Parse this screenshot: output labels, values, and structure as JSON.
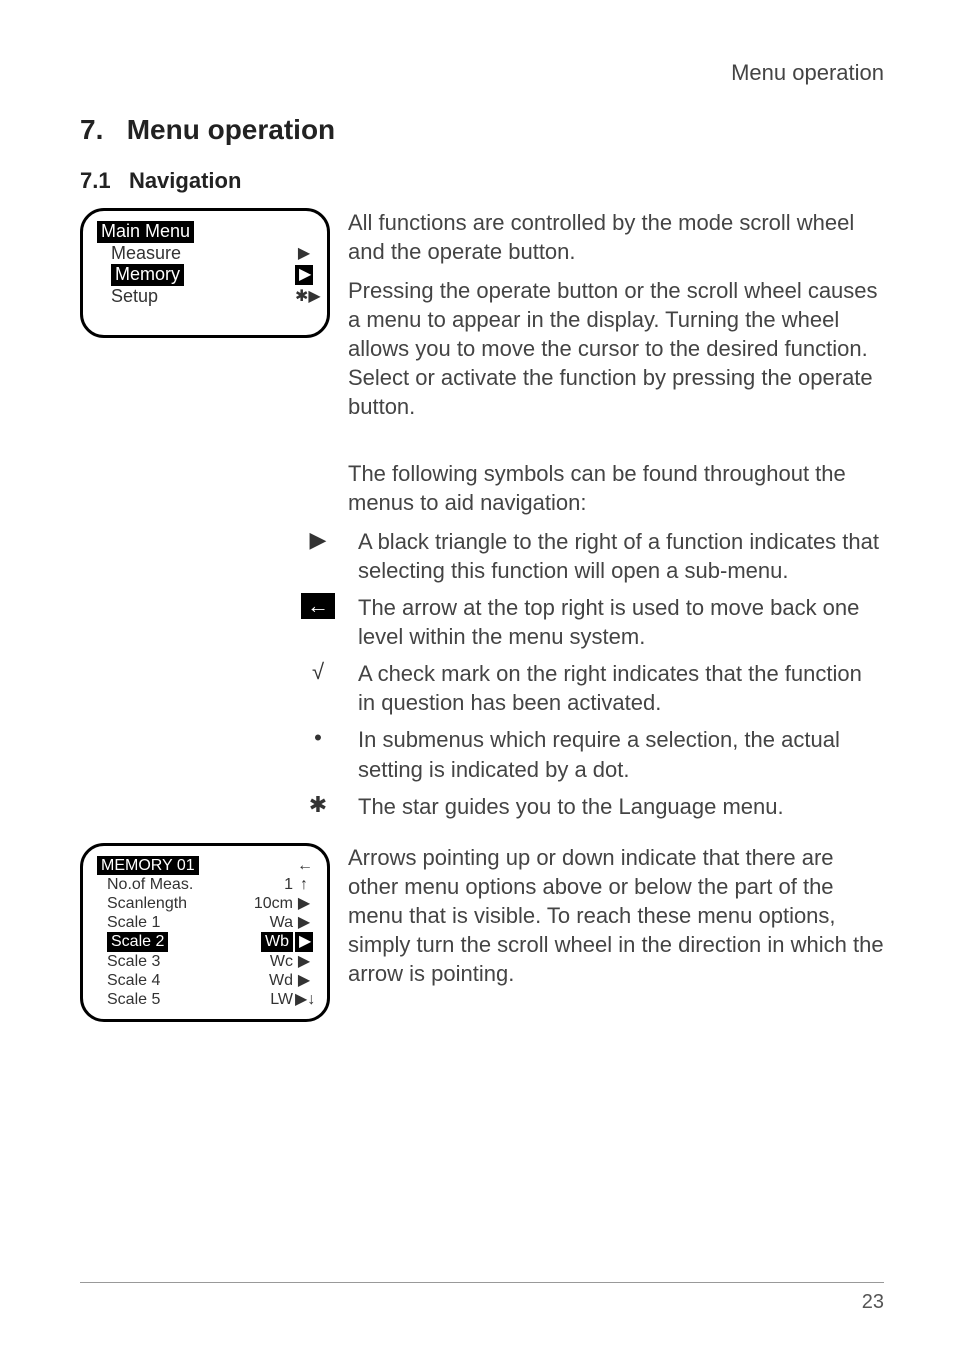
{
  "header": {
    "running": "Menu operation"
  },
  "h1": {
    "num": "7.",
    "title": "Menu operation"
  },
  "h2": {
    "num": "7.1",
    "title": "Navigation"
  },
  "lcd1": {
    "title": "Main Menu",
    "rows": [
      {
        "label": "Measure",
        "arrow": "▶",
        "hl": false
      },
      {
        "label": "Memory",
        "arrow": "▶",
        "hl": true
      },
      {
        "label": "Setup",
        "arrow": "✱▶",
        "hl": false
      }
    ]
  },
  "para1": "All functions are controlled by the mode scroll wheel and the operate button.",
  "para2": "Pressing the operate button or the scroll wheel causes a menu to appear in the display. Turning the wheel allows you to move the cursor to the desired function. Select or activate the function by pressing the operate button.",
  "navIntro": "The following symbols can be found throughout the menus to aid navigation:",
  "symbols": [
    {
      "glyph": "▶",
      "desc": "A black triangle to the right of a function indicates that selecting this function will open a sub-menu."
    },
    {
      "glyph": "←",
      "desc": "The arrow at the top right is used to move back one level within the menu system."
    },
    {
      "glyph": "√",
      "desc": "A check mark on the right indicates that the function in question has been activated."
    },
    {
      "glyph": "•",
      "desc": "In submenus which require a selection, the actual setting is indicated by a dot."
    },
    {
      "glyph": "✱",
      "desc": "The star guides you to the Language menu."
    }
  ],
  "lcd2": {
    "title": "MEMORY 01",
    "back": "←",
    "up": "↑",
    "down": "↓",
    "rows": [
      {
        "label": "No.of Meas.",
        "val": "1",
        "arrow": "",
        "hl": false
      },
      {
        "label": "Scanlength",
        "val": "10cm",
        "arrow": "▶",
        "hl": false
      },
      {
        "label": "Scale  1",
        "val": "Wa",
        "arrow": "▶",
        "hl": false
      },
      {
        "label": "Scale  2",
        "val": "Wb",
        "arrow": "▶",
        "hl": true
      },
      {
        "label": "Scale  3",
        "val": "Wc",
        "arrow": "▶",
        "hl": false
      },
      {
        "label": "Scale  4",
        "val": "Wd",
        "arrow": "▶",
        "hl": false
      },
      {
        "label": "Scale  5",
        "val": "LW",
        "arrow": "▶",
        "hl": false
      }
    ]
  },
  "para3": "Arrows pointing up or down indicate that there are other menu options above or below the part of the menu that is visible. To reach these menu options, simply turn the scroll wheel in the direction in which the arrow is pointing.",
  "footer": {
    "page": "23"
  }
}
